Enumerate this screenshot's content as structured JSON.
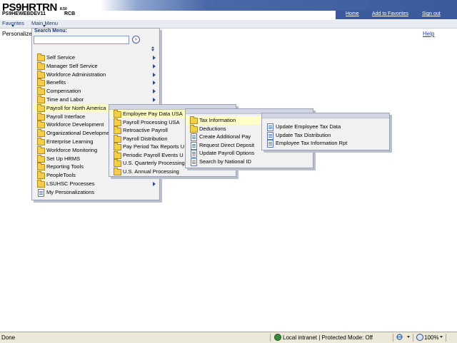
{
  "header": {
    "app_name": "PS9HRTRN",
    "version": "8.50",
    "database": "PS9HEWEBDEV11",
    "user": "RCB",
    "links": [
      "Home",
      "Add to Favorites",
      "Sign out"
    ]
  },
  "menubar": {
    "favorites": "Favorites",
    "main_menu": "Main Menu"
  },
  "page": {
    "personalize": "Personalize",
    "help": "Help"
  },
  "search": {
    "label": "Search Menu:",
    "value": "",
    "go_glyph": "»"
  },
  "menus": {
    "main": [
      {
        "label": "Self Service",
        "type": "folder",
        "submenu": true
      },
      {
        "label": "Manager Self Service",
        "type": "folder",
        "submenu": true
      },
      {
        "label": "Workforce Administration",
        "type": "folder",
        "submenu": true
      },
      {
        "label": "Benefits",
        "type": "folder",
        "submenu": true
      },
      {
        "label": "Compensation",
        "type": "folder",
        "submenu": true
      },
      {
        "label": "Time and Labor",
        "type": "folder",
        "submenu": true
      },
      {
        "label": "Payroll for North America",
        "type": "folder",
        "submenu": true,
        "selected": true
      },
      {
        "label": "Payroll Interface",
        "type": "folder",
        "submenu": true
      },
      {
        "label": "Workforce Development",
        "type": "folder",
        "submenu": true
      },
      {
        "label": "Organizational Developme",
        "type": "folder",
        "submenu": true
      },
      {
        "label": "Enterprise Learning",
        "type": "folder",
        "submenu": true
      },
      {
        "label": "Workforce Monitoring",
        "type": "folder",
        "submenu": true
      },
      {
        "label": "Set Up HRMS",
        "type": "folder",
        "submenu": true
      },
      {
        "label": "Reporting Tools",
        "type": "folder",
        "submenu": true
      },
      {
        "label": "PeopleTools",
        "type": "folder",
        "submenu": true
      },
      {
        "label": "LSUHSC Processes",
        "type": "folder",
        "submenu": true
      },
      {
        "label": "My Personalizations",
        "type": "doc",
        "submenu": false
      }
    ],
    "payroll": [
      {
        "label": "Employee Pay Data USA",
        "type": "folder",
        "selected": true
      },
      {
        "label": "Payroll Processing USA",
        "type": "folder"
      },
      {
        "label": "Retroactive Payroll",
        "type": "folder"
      },
      {
        "label": "Payroll Distribution",
        "type": "folder"
      },
      {
        "label": "Pay Period Tax Reports U",
        "type": "folder"
      },
      {
        "label": "Periodic Payroll Events U",
        "type": "folder"
      },
      {
        "label": "U.S. Quarterly Processing",
        "type": "folder"
      },
      {
        "label": "U.S. Annual Processing",
        "type": "folder"
      }
    ],
    "pay_data": [
      {
        "label": "Tax Information",
        "type": "folder",
        "selected": true
      },
      {
        "label": "Deductions",
        "type": "folder"
      },
      {
        "label": "Create Additional Pay",
        "type": "doc"
      },
      {
        "label": "Request Direct Deposit",
        "type": "doc"
      },
      {
        "label": "Update Payroll Options",
        "type": "doc"
      },
      {
        "label": "Search by National ID",
        "type": "doc"
      }
    ],
    "tax_info": [
      {
        "label": "Update Employee Tax Data",
        "type": "doc"
      },
      {
        "label": "Update Tax Distribution",
        "type": "doc"
      },
      {
        "label": "Employee Tax Information Rpt",
        "type": "doc"
      }
    ]
  },
  "statusbar": {
    "left": "Done",
    "zone": "Local intranet | Protected Mode: Off",
    "zoom": "100%"
  },
  "colors": {
    "header_blue": "#3a5a9c",
    "menu_bg": "#f1f1f1",
    "selected_bg": "#ffffc8",
    "link": "#1a45a0"
  }
}
